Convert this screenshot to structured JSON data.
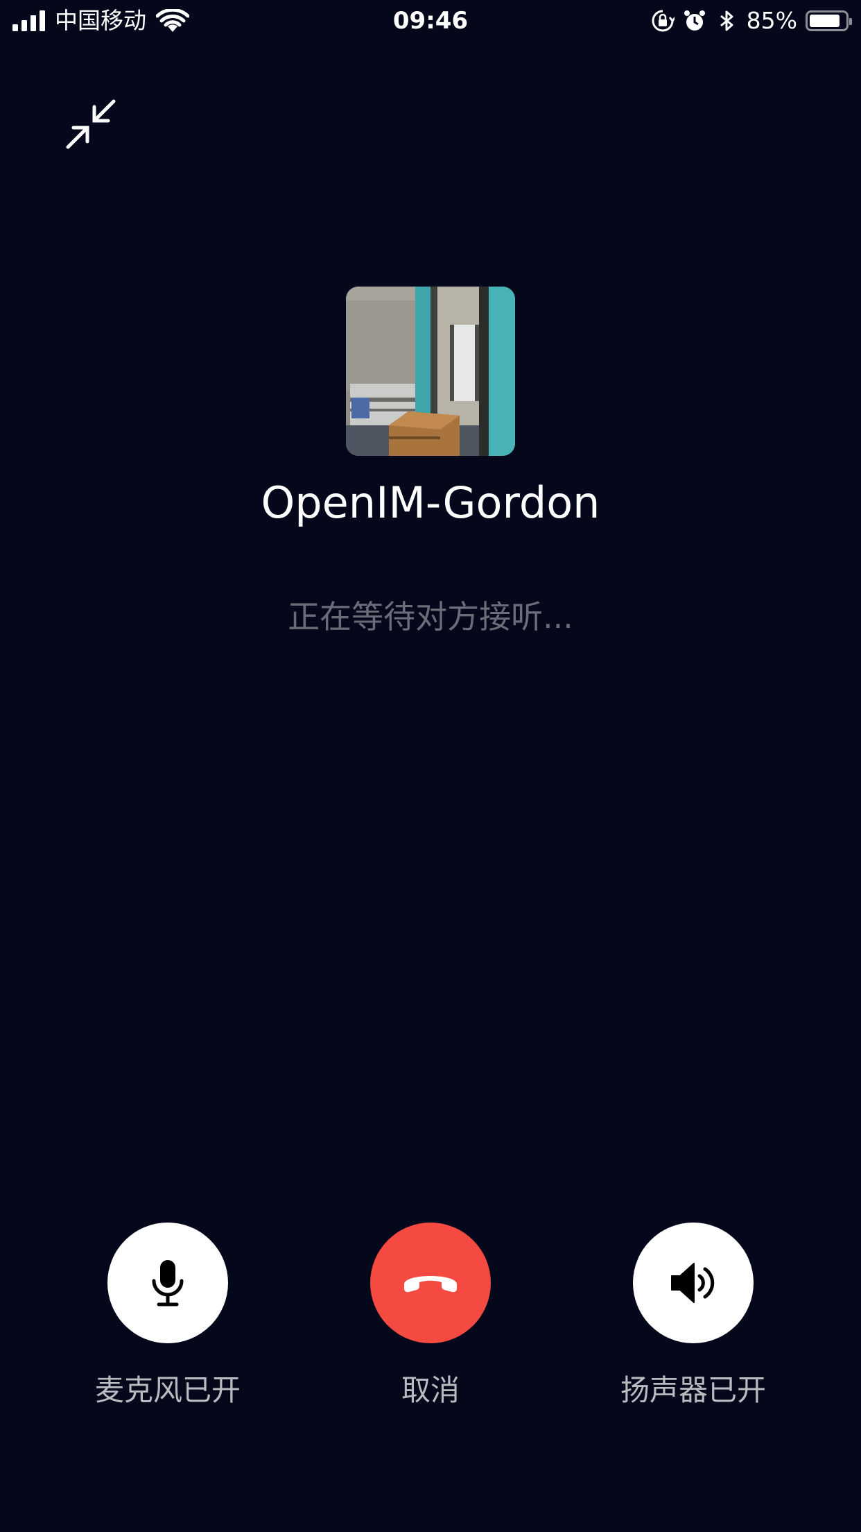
{
  "status_bar": {
    "carrier": "中国移动",
    "time": "09:46",
    "battery_percent": "85%",
    "battery_level": 0.85,
    "icons": [
      "signal-icon",
      "wifi-icon",
      "orientation-lock-icon",
      "alarm-icon",
      "bluetooth-icon",
      "battery-icon"
    ]
  },
  "call": {
    "caller_name": "OpenIM-Gordon",
    "status_text": "正在等待对方接听..."
  },
  "controls": {
    "mic_label": "麦克风已开",
    "cancel_label": "取消",
    "speaker_label": "扬声器已开",
    "icons": [
      "minimize-icon",
      "microphone-icon",
      "hang-up-icon",
      "speaker-icon"
    ]
  },
  "colors": {
    "background": "#05081a",
    "hangup": "#f44a42",
    "label": "#b9bbc1",
    "status_text": "#6a6d78"
  }
}
